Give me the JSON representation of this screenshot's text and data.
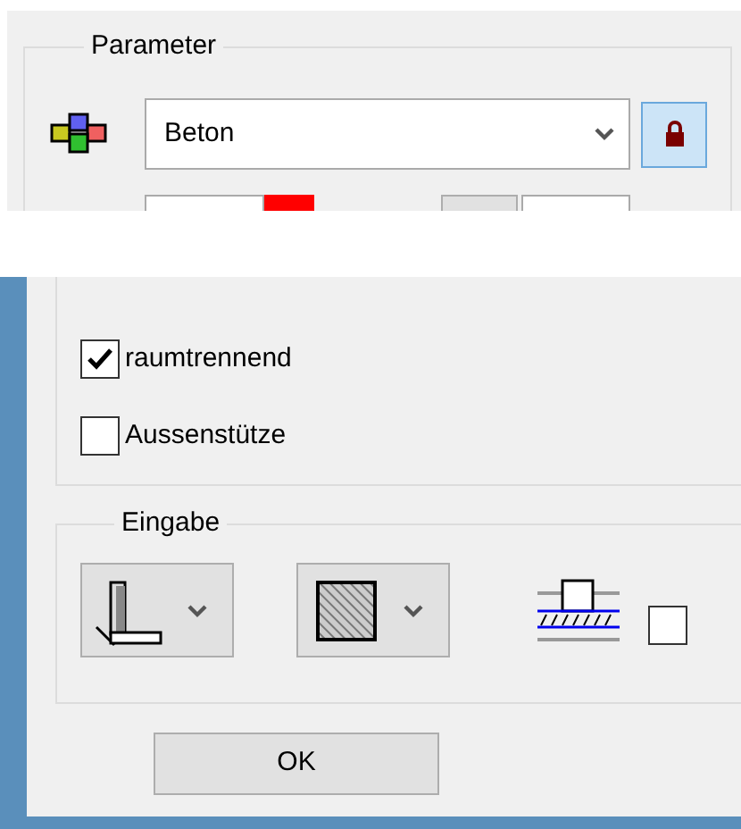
{
  "parameter": {
    "title": "Parameter",
    "material": "Beton"
  },
  "options": [
    {
      "label": "raumtrennend",
      "checked": true
    },
    {
      "label": "Aussenstütze",
      "checked": false
    }
  ],
  "input": {
    "title": "Eingabe",
    "base_checked": false
  },
  "ok_button": "OK"
}
